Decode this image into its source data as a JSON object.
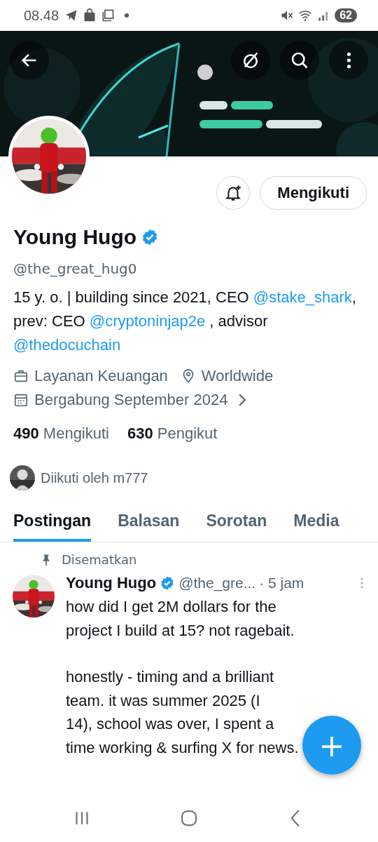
{
  "status_bar": {
    "time": "08.48",
    "battery": "62"
  },
  "profile": {
    "name": "Young Hugo",
    "verified": true,
    "handle": "@the_great_hug0",
    "follow_button": "Mengikuti",
    "bio": [
      {
        "kind": "text",
        "text": "15 y. o. | building since 2021, CEO "
      },
      {
        "kind": "mention",
        "text": "@stake_shark"
      },
      {
        "kind": "text",
        "text": ", prev: CEO "
      },
      {
        "kind": "mention",
        "text": "@cryptoninjap2e"
      },
      {
        "kind": "text",
        "text": " , advisor "
      },
      {
        "kind": "mention",
        "text": "@thedocuchain"
      }
    ],
    "meta": [
      {
        "kind": "category",
        "text": "Layanan Keuangan"
      },
      {
        "kind": "location",
        "text": "Worldwide"
      },
      {
        "kind": "joined",
        "text": "Bergabung September 2024",
        "chevron": true
      }
    ],
    "stats": [
      {
        "count": "490",
        "label": "Mengikuti"
      },
      {
        "count": "630",
        "label": "Pengikut"
      }
    ],
    "followed_by": "Diikuti oleh m777"
  },
  "tabs": [
    {
      "label": "Postingan",
      "selected": true
    },
    {
      "label": "Balasan",
      "selected": false
    },
    {
      "label": "Sorotan",
      "selected": false
    },
    {
      "label": "Media",
      "selected": false
    }
  ],
  "post": {
    "pinned_label": "Disematkan",
    "author": "Young Hugo",
    "verified": true,
    "handle": "@the_gre...",
    "time": "· 5 jam",
    "paragraphs": [
      {
        "lines": [
          "how did I get 2M dollars for the",
          "project I build at 15? not ragebait."
        ]
      },
      {
        "lines": [
          "honestly - timing and a brilliant",
          "team. it was summer 2025 (I",
          "14), school was over, I spent a",
          "time working & surfing X for news."
        ]
      }
    ]
  },
  "fab": {
    "label": "+"
  }
}
